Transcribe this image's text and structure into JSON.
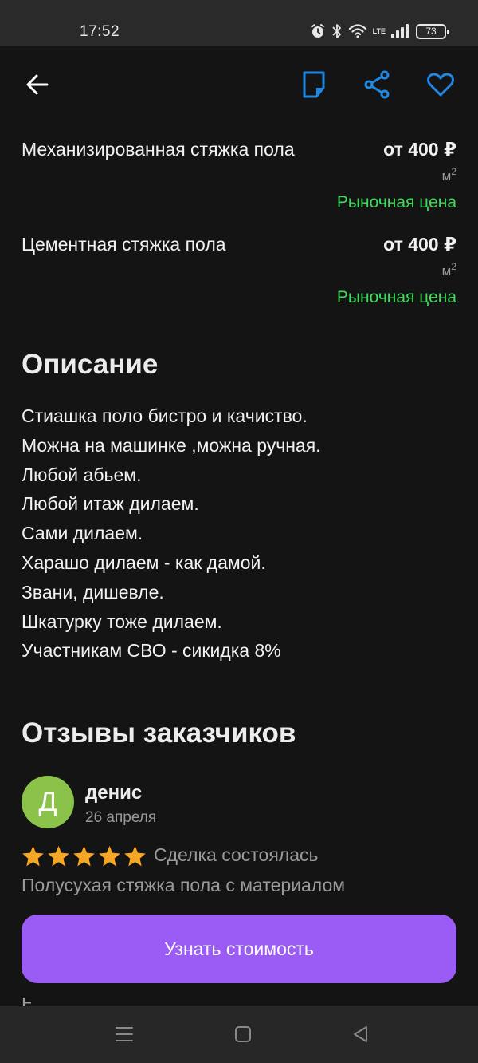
{
  "status_bar": {
    "time": "17:52",
    "network_label": "LTE",
    "battery_level": "73"
  },
  "app_bar": {
    "back_icon": "arrow-left-icon",
    "note_icon": "note-icon",
    "share_icon": "share-icon",
    "favorite_icon": "heart-icon",
    "accent_color": "#1e88e5"
  },
  "prices": [
    {
      "name": "Механизированная стяжка пола",
      "price": "от 400 ₽",
      "unit": "м",
      "unit_sup": "2",
      "tag": "Рыночная цена"
    },
    {
      "name": "Цементная стяжка пола",
      "price": "от 400 ₽",
      "unit": "м",
      "unit_sup": "2",
      "tag": "Рыночная цена"
    }
  ],
  "description": {
    "title": "Описание",
    "lines": [
      "Стиашка поло бистро и качиство.",
      "Можна на машинке ,можна ручная.",
      "Любой абьем.",
      "Любой итаж дилаем.",
      "Сами дилаем.",
      "Харашо дилаем - как дамой.",
      "Звани, дишевле.",
      "Шкатурку тоже дилаем.",
      "Участникам СВО - сикидка 8%"
    ]
  },
  "reviews": {
    "title": "Отзывы заказчиков",
    "items": [
      {
        "avatar_letter": "Д",
        "avatar_color": "#8bc34a",
        "name": "денис",
        "date": "26 апреля",
        "rating": 5,
        "status": "Сделка состоялась",
        "service": "Полусухая стяжка пола с материалом"
      }
    ]
  },
  "cta": {
    "label": "Узнать стоимость",
    "color": "#9b5cf5"
  },
  "colors": {
    "background": "#141414",
    "market_price": "#3ddc5c",
    "star": "#f5a623"
  },
  "nav_bar": {
    "menu_icon": "menu-icon",
    "home_icon": "square-icon",
    "back_icon": "triangle-back-icon"
  }
}
